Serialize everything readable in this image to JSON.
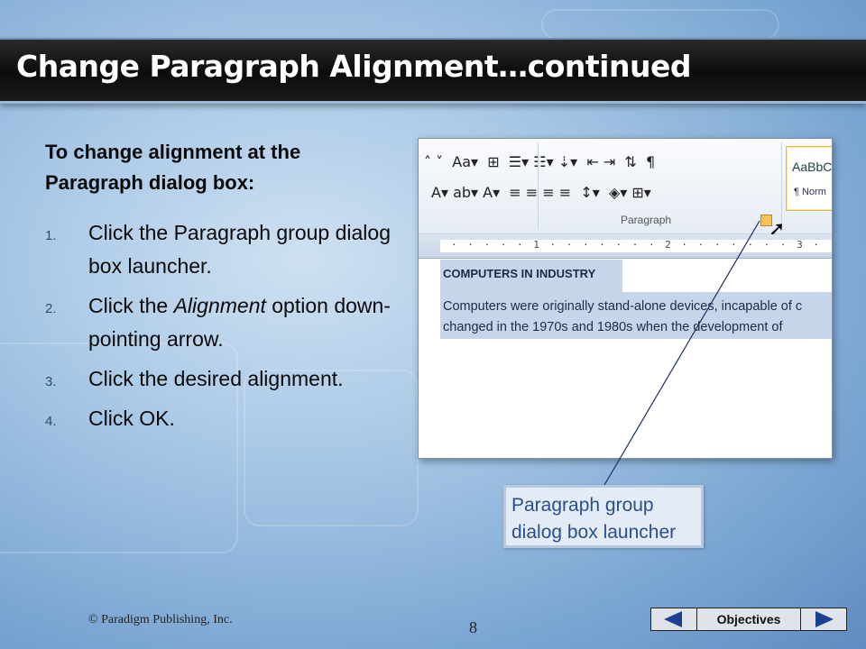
{
  "slide": {
    "title": "Change Paragraph Alignment…continued",
    "intro": "To change alignment at the Paragraph dialog box:",
    "steps": [
      {
        "num": "1.",
        "text": "Click the Paragraph group dialog box launcher."
      },
      {
        "num": "2.",
        "text_before": "Click the ",
        "text_italic": "Alignment",
        "text_after": " option down-pointing arrow."
      },
      {
        "num": "3.",
        "text": "Click the desired alignment."
      },
      {
        "num": "4.",
        "text": "Click OK."
      }
    ]
  },
  "screenshot": {
    "ribbon": {
      "row1": "˄ ˅  Aa▾  ⊞  ☰▾ ☷▾ ⇣▾  ⇤ ⇥  ⇅  ¶",
      "row2": "A▾ ab▾ A▾  ≡ ≡ ≡ ≡  ↕▾  ◈▾ ⊞▾",
      "group_label": "Paragraph",
      "styles_sample": "AaBbC",
      "styles_name": "¶ Norm"
    },
    "ruler_marks": "· · · · · 1 · · · · · · · 2 · · · · · · · 3 · · · · ·",
    "document": {
      "heading": "COMPUTERS IN INDUSTRY",
      "line1": "Computers were originally stand-alone devices, incapable of c",
      "line2": "changed in the 1970s and 1980s when the development of"
    }
  },
  "callout": {
    "line1": "Paragraph group",
    "line2": "dialog box launcher"
  },
  "footer": {
    "copyright": "© Paradigm Publishing, Inc.",
    "page_number": "8",
    "objectives_label": "Objectives",
    "prev_icon": "triangle-left-icon",
    "next_icon": "triangle-right-icon"
  },
  "colors": {
    "title_bar": "#111111",
    "callout_text": "#2a4f8a",
    "nav_arrow": "#1d3f8f"
  }
}
